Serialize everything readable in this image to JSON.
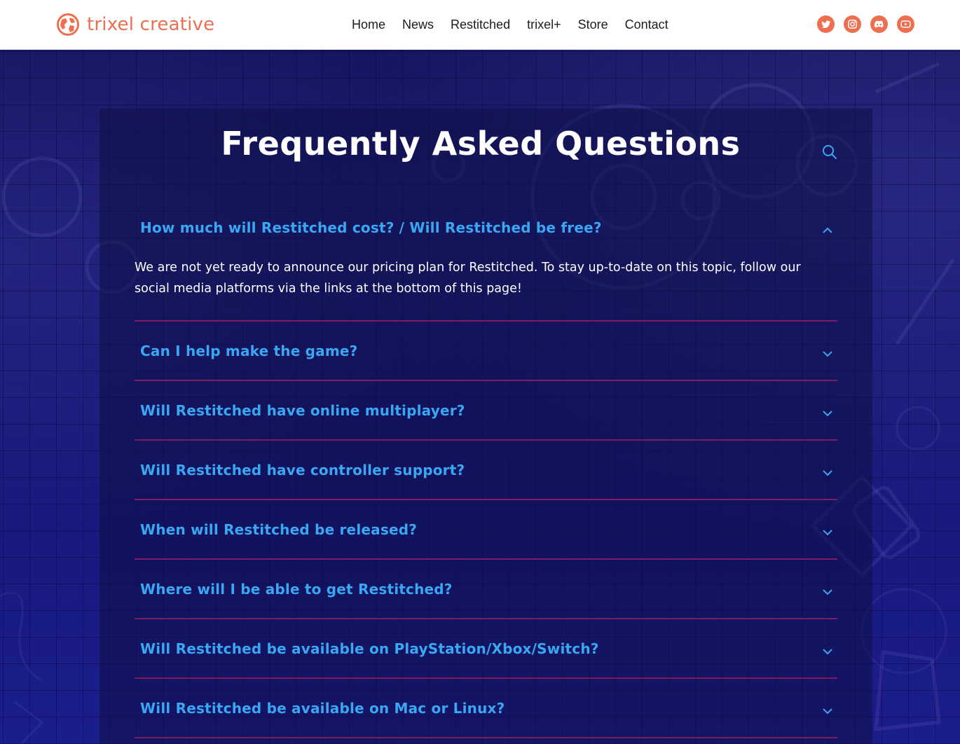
{
  "header": {
    "logo_text": "trixel creative",
    "nav": [
      "Home",
      "News",
      "Restitched",
      "trixel+",
      "Store",
      "Contact"
    ],
    "social_icons": [
      "twitter-icon",
      "instagram-icon",
      "discord-icon",
      "youtube-icon"
    ]
  },
  "colors": {
    "brand": "#ee6f4f",
    "question": "#3aa7f2",
    "divider": "#7a1d63",
    "background": "#16176a"
  },
  "faq": {
    "title": "Frequently Asked Questions",
    "items": [
      {
        "question": "How much will Restitched cost? / Will Restitched be free?",
        "answer": "We are not yet ready to announce our pricing plan for Restitched. To stay up-to-date on this topic, follow our social media platforms via the links at the bottom of this page!",
        "open": true
      },
      {
        "question": "Can I help make the game?",
        "open": false
      },
      {
        "question": "Will Restitched have online multiplayer?",
        "open": false
      },
      {
        "question": "Will Restitched have controller support?",
        "open": false
      },
      {
        "question": "When will Restitched be released?",
        "open": false
      },
      {
        "question": "Where will I be able to get Restitched?",
        "open": false
      },
      {
        "question": "Will Restitched be available on PlayStation/Xbox/Switch?",
        "open": false
      },
      {
        "question": "Will Restitched be available on Mac or Linux?",
        "open": false
      }
    ]
  }
}
